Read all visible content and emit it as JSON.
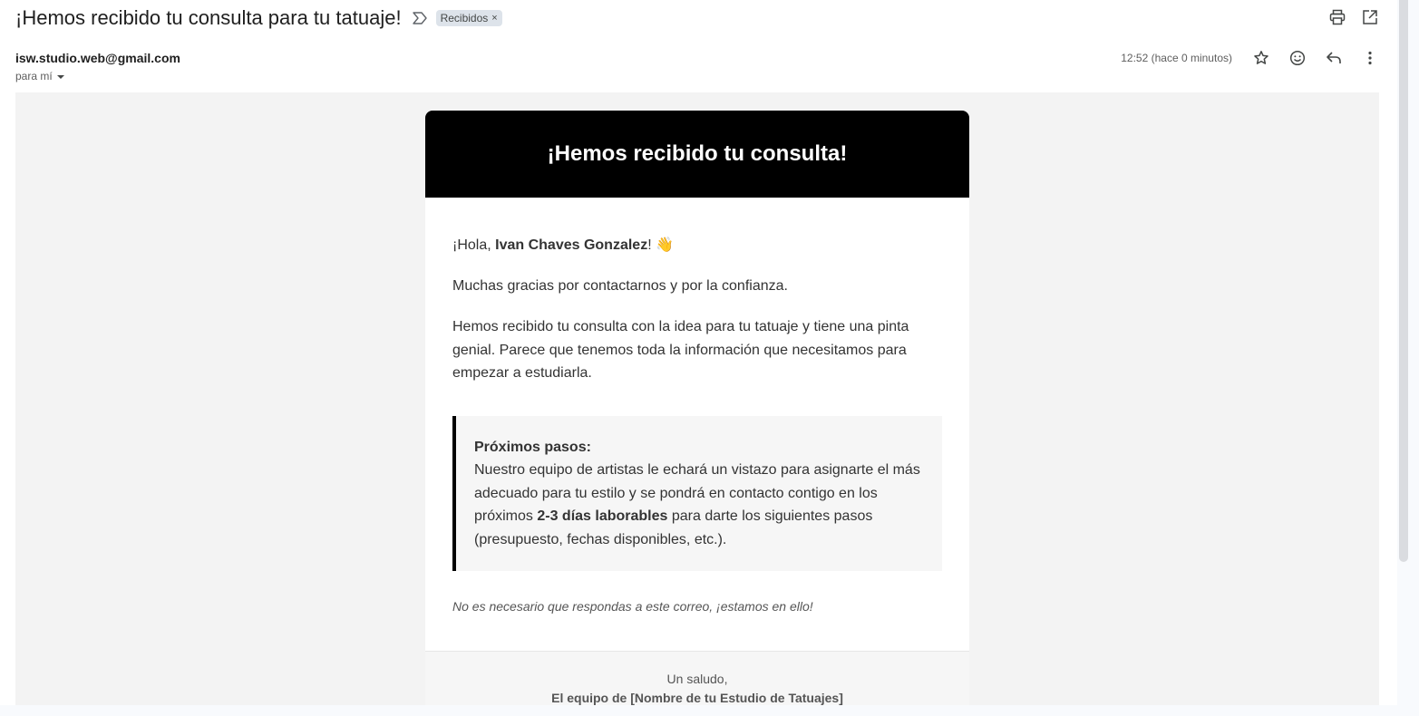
{
  "email": {
    "subject": "¡Hemos recibido tu consulta para tu tatuaje!",
    "label": "Recibidos",
    "label_remove": "×",
    "sender": "isw.studio.web@gmail.com",
    "recipient": "para mí",
    "timestamp": "12:52 (hace 0 minutos)"
  },
  "icons": {
    "important": "important-marker-icon",
    "print": "printer-icon",
    "open_new_window": "open-in-new-window-icon",
    "star": "star-icon",
    "emoji": "emoji-reaction-icon",
    "reply": "reply-icon",
    "more": "more-vertical-icon",
    "recipient_details": "caret-down-icon"
  },
  "body": {
    "header_title": "¡Hemos recibido tu consulta!",
    "greeting_prefix": "¡Hola, ",
    "greeting_name": "Ivan Chaves Gonzalez",
    "greeting_suffix": "! 👋",
    "para1": "Muchas gracias por contactarnos y por la confianza.",
    "para2": "Hemos recibido tu consulta con la idea para tu tatuaje y tiene una pinta genial. Parece que tenemos toda la información que necesitamos para empezar a estudiarla.",
    "steps_title": "Próximos pasos:",
    "steps_text_1": "Nuestro equipo de artistas le echará un vistazo para asignarte el más adecuado para tu estilo y se pondrá en contacto contigo en los próximos ",
    "steps_bold": "2-3 días laborables",
    "steps_text_2": " para darte los siguientes pasos (presupuesto, fechas disponibles, etc.).",
    "note": "No es necesario que respondas a este correo, ¡estamos en ello!",
    "footer_greeting": "Un saludo,",
    "footer_team": "El equipo de [Nombre de tu Estudio de Tatuajes]"
  },
  "colors": {
    "header_bg": "#000000",
    "body_bg": "#f3f3f3",
    "chip_bg": "#dde3ea"
  }
}
